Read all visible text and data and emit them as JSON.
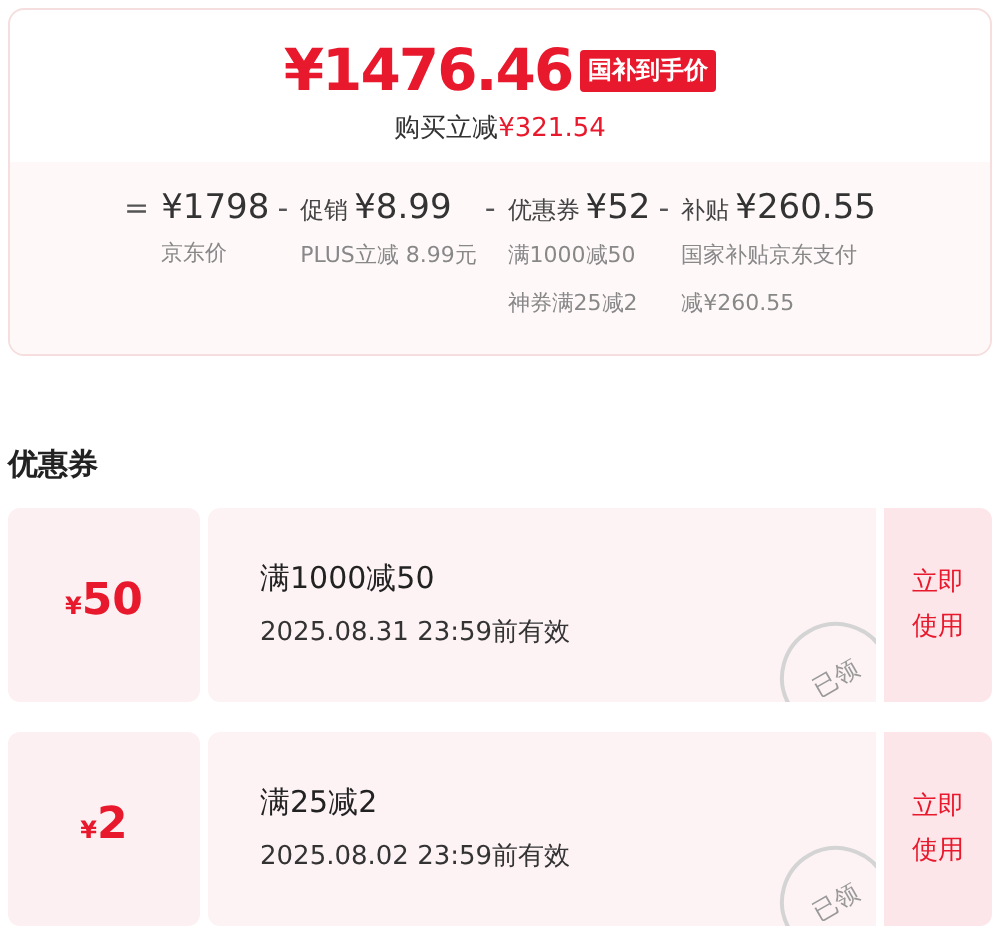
{
  "price": {
    "amount": "¥1476.46",
    "tag": "国补到手价",
    "saving_label": "购买立减",
    "saving_amount": "¥321.54"
  },
  "breakdown": [
    {
      "op": "=",
      "amount": "¥1798",
      "notes": [
        "京东价"
      ]
    },
    {
      "op": "-",
      "label": "促销",
      "amount": "¥8.99",
      "notes": [
        "PLUS立减 8.99元"
      ]
    },
    {
      "op": "-",
      "label": "优惠券",
      "amount": "¥52",
      "notes": [
        "满1000减50",
        "神券满25减2"
      ]
    },
    {
      "op": "-",
      "label": "补贴",
      "amount": "¥260.55",
      "notes": [
        "国家补贴京东支付",
        "减¥260.55"
      ]
    }
  ],
  "coupons_title": "优惠券",
  "coupons": [
    {
      "currency": "¥",
      "amount": "50",
      "title": "满1000减50",
      "validity": "2025.08.31 23:59前有效",
      "stamp": "已领",
      "action": "立即使用"
    },
    {
      "currency": "¥",
      "amount": "2",
      "title": "满25减2",
      "validity": "2025.08.02 23:59前有效",
      "stamp": "已领",
      "action": "立即使用"
    }
  ]
}
